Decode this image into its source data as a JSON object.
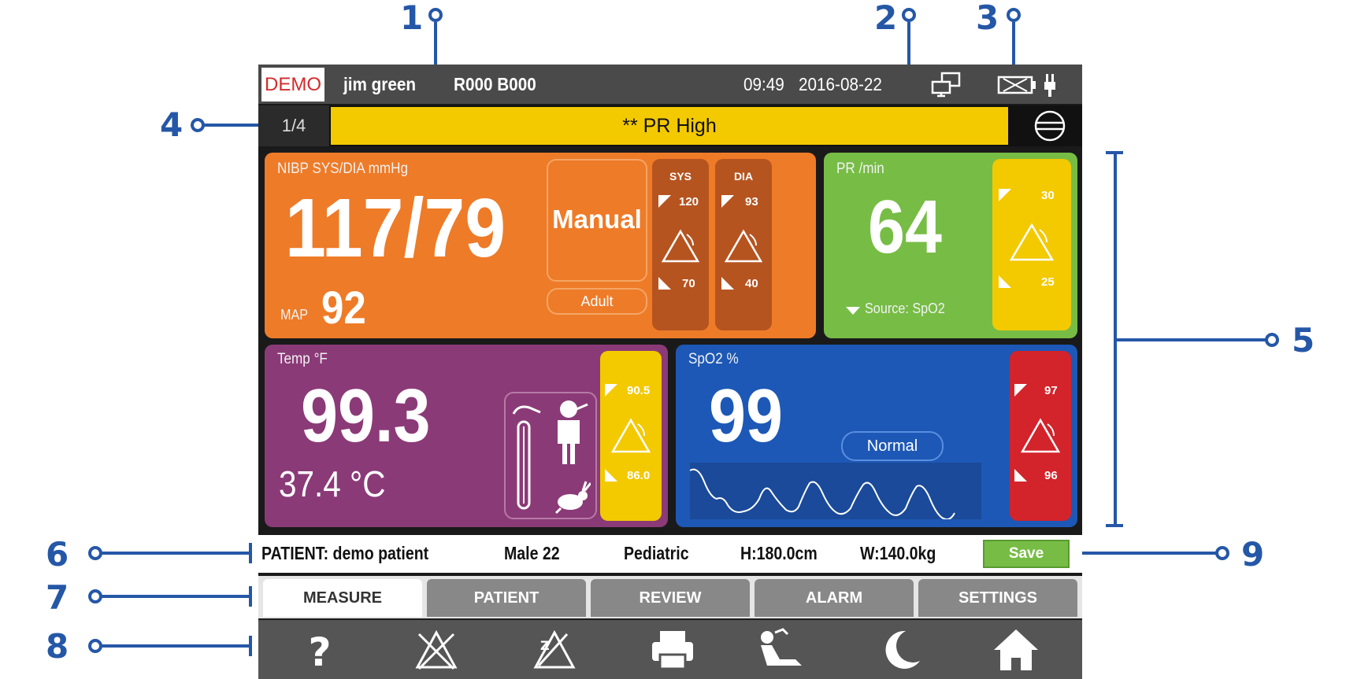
{
  "callouts": [
    "1",
    "2",
    "3",
    "4",
    "5",
    "6",
    "7",
    "8",
    "9"
  ],
  "header": {
    "demo": "DEMO",
    "patient_name": "jim green",
    "bed_id": "R000 B000",
    "time": "09:49",
    "date": "2016-08-22"
  },
  "alarm": {
    "page": "1/4",
    "message": "**   PR High"
  },
  "nibp": {
    "label": "NIBP SYS/DIA mmHg",
    "value": "117/79",
    "mode": "Manual",
    "patient_type": "Adult",
    "map_label": "MAP",
    "map_value": "92",
    "sys_header": "SYS",
    "sys_high": "120",
    "sys_low": "70",
    "dia_header": "DIA",
    "dia_high": "93",
    "dia_low": "40"
  },
  "pr": {
    "label": "PR /min",
    "value": "64",
    "source": "Source: SpO2",
    "high": "30",
    "low": "25"
  },
  "temp": {
    "label": "Temp °F",
    "value": "99.3",
    "secondary": "37.4 °C",
    "high": "90.5",
    "low": "86.0"
  },
  "spo2": {
    "label": "SpO2 %",
    "value": "99",
    "status": "Normal",
    "high": "97",
    "low": "96"
  },
  "info": {
    "patient": "PATIENT: demo patient",
    "sex_age": "Male 22",
    "category": "Pediatric",
    "height": "H:180.0cm",
    "weight": "W:140.0kg",
    "save": "Save"
  },
  "tabs": [
    "MEASURE",
    "PATIENT",
    "REVIEW",
    "ALARM",
    "SETTINGS"
  ],
  "toolbar_icons": [
    "help-icon",
    "alarm-off-icon",
    "alarm-pause-icon",
    "printer-icon",
    "patient-position-icon",
    "night-mode-icon",
    "home-icon"
  ],
  "colors": {
    "nibp": "#ee7b28",
    "pr": "#77bd45",
    "temp": "#8b3a78",
    "spo2": "#1d58b6",
    "alarm": "#f3c900",
    "callout": "#2557a7"
  }
}
